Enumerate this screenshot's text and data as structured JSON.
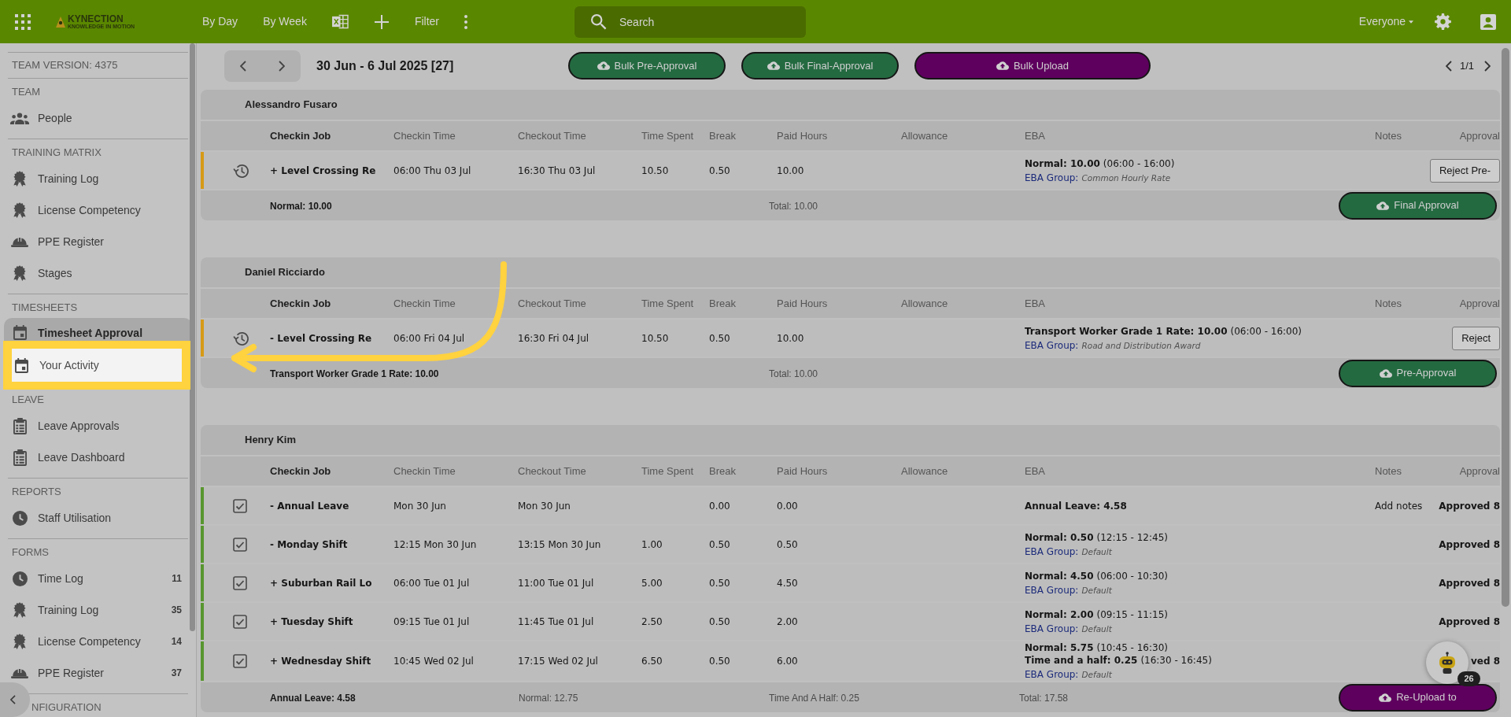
{
  "top_bar": {
    "logo": {
      "name": "KYNECTION",
      "tagline": "KNOWLEDGE IN MOTION"
    },
    "nav": [
      {
        "kind": "text",
        "label": "By Day"
      },
      {
        "kind": "text",
        "label": "By Week"
      },
      {
        "kind": "spreadsheet"
      },
      {
        "kind": "add"
      },
      {
        "kind": "text",
        "label": "Filter"
      },
      {
        "kind": "more"
      }
    ],
    "search": {
      "placeholder": "Search"
    },
    "scope": "Everyone"
  },
  "sidebar": {
    "version": "TEAM VERSION: 4375",
    "sections": [
      {
        "title": "TEAM",
        "items": [
          {
            "kind": "people",
            "label": "People",
            "selected": false,
            "highlighted": false
          }
        ]
      },
      {
        "title": "TRAINING MATRIX",
        "items": [
          {
            "kind": "award",
            "label": "Training Log",
            "selected": false,
            "highlighted": false
          },
          {
            "kind": "award",
            "label": "License Competency",
            "selected": false,
            "highlighted": false
          },
          {
            "kind": "hardhat",
            "label": "PPE Register",
            "selected": false,
            "highlighted": false
          },
          {
            "kind": "award",
            "label": "Stages",
            "selected": false,
            "highlighted": false
          }
        ]
      },
      {
        "title": "TIMESHEETS",
        "items": [
          {
            "kind": "calendar",
            "label": "Timesheet Approval",
            "selected": true,
            "highlighted": false
          },
          {
            "kind": "calendar",
            "label": "Your Activity",
            "selected": false,
            "highlighted": true
          }
        ]
      },
      {
        "title": "LEAVE",
        "items": [
          {
            "kind": "clipboard",
            "label": "Leave Approvals",
            "selected": false,
            "highlighted": false
          },
          {
            "kind": "clipboard",
            "label": "Leave Dashboard",
            "selected": false,
            "highlighted": false
          }
        ]
      },
      {
        "title": "REPORTS",
        "items": [
          {
            "kind": "clock",
            "label": "Staff Utilisation",
            "selected": false,
            "highlighted": false
          }
        ]
      },
      {
        "title": "FORMS",
        "items": [
          {
            "kind": "clock",
            "label": "Time Log",
            "count": "11",
            "selected": false,
            "highlighted": false
          },
          {
            "kind": "award",
            "label": "Training Log",
            "count": "35",
            "selected": false,
            "highlighted": false
          },
          {
            "kind": "award",
            "label": "License Competency",
            "count": "14",
            "selected": false,
            "highlighted": false
          },
          {
            "kind": "hardhat",
            "label": "PPE Register",
            "count": "37",
            "selected": false,
            "highlighted": false
          }
        ]
      }
    ],
    "bottom_heading": "NFIGURATION"
  },
  "toolbar": {
    "date_range": "30 Jun - 6 Jul 2025 [27]",
    "actions": [
      {
        "kind": "approve",
        "label": "Bulk Pre-Approval"
      },
      {
        "kind": "approve",
        "label": "Bulk Final-Approval"
      },
      {
        "kind": "upload",
        "label": "Bulk Upload"
      }
    ],
    "page": "1/1"
  },
  "timesheets": [
    {
      "name": "Alessandro Fusaro",
      "columns": [
        "Checkin Job",
        "Checkin Time",
        "Checkout Time",
        "Time Spent",
        "Break",
        "Paid Hours",
        "Allowance",
        "EBA",
        "Notes",
        "Approval"
      ],
      "rows": [
        {
          "kind": "clock",
          "color": "#d69a17",
          "job": "+ Level Crossing Re",
          "checkin": "06:00 Thu 03 Jul",
          "checkout": "16:30 Thu 03 Jul",
          "time_spent": "10.50",
          "break": "0.50",
          "paid_hours": "10.00",
          "eba": [
            {
              "amount": "Normal: 10.00",
              "range": "(06:00 - 16:00)"
            }
          ],
          "group_label": "EBA Group:",
          "group": "Common Hourly Rate",
          "approval": {
            "kind": "button",
            "label": "Reject Pre-"
          }
        }
      ],
      "footer": {
        "summary": "Normal: 10.00",
        "totals": [
          "Total: 10.00"
        ],
        "action": {
          "kind": "approve",
          "label": "Final Approval"
        }
      }
    },
    {
      "name": "Daniel Ricciardo",
      "columns": [
        "Checkin Job",
        "Checkin Time",
        "Checkout Time",
        "Time Spent",
        "Break",
        "Paid Hours",
        "Allowance",
        "EBA",
        "Notes",
        "Approval"
      ],
      "rows": [
        {
          "kind": "clock",
          "color": "#d69a17",
          "job": "- Level Crossing Re",
          "checkin": "06:00 Fri 04 Jul",
          "checkout": "16:30 Fri 04 Jul",
          "time_spent": "10.50",
          "break": "0.50",
          "paid_hours": "10.00",
          "eba": [
            {
              "amount": "Transport Worker Grade 1 Rate: 10.00",
              "range": "(06:00 - 16:00)"
            }
          ],
          "group_label": "EBA Group:",
          "group": "Road and Distribution Award",
          "approval": {
            "kind": "button",
            "label": "Reject"
          }
        }
      ],
      "footer": {
        "summary": "Transport Worker Grade 1 Rate: 10.00",
        "totals": [
          "Total: 10.00"
        ],
        "action": {
          "kind": "approve",
          "label": "Pre-Approval"
        }
      }
    },
    {
      "name": "Henry Kim",
      "columns": [
        "Checkin Job",
        "Checkin Time",
        "Checkout Time",
        "Time Spent",
        "Break",
        "Paid Hours",
        "Allowance",
        "EBA",
        "Notes",
        "Approval"
      ],
      "rows": [
        {
          "kind": "checkbox",
          "checked": true,
          "color": "#58962f",
          "job": "- Annual Leave",
          "checkin": "Mon 30 Jun",
          "checkout": "Mon 30 Jun",
          "break": "0.00",
          "paid_hours": "0.00",
          "eba": [
            {
              "amount": "Annual Leave: 4.58"
            }
          ],
          "notes": "Add notes",
          "approval": {
            "kind": "status",
            "label": "Approved 8"
          }
        },
        {
          "kind": "checkbox",
          "checked": true,
          "color": "#58962f",
          "job": "- Monday Shift",
          "checkin": "12:15 Mon 30 Jun",
          "checkout": "13:15 Mon 30 Jun",
          "time_spent": "1.00",
          "break": "0.50",
          "paid_hours": "0.50",
          "eba": [
            {
              "amount": "Normal: 0.50",
              "range": "(12:15 - 12:45)"
            }
          ],
          "group_label": "EBA Group:",
          "group": "Default",
          "approval": {
            "kind": "status",
            "label": "Approved 8"
          }
        },
        {
          "kind": "checkbox",
          "checked": true,
          "color": "#58962f",
          "job": "+ Suburban Rail Lo",
          "checkin": "06:00 Tue 01 Jul",
          "checkout": "11:00 Tue 01 Jul",
          "time_spent": "5.00",
          "break": "0.50",
          "paid_hours": "4.50",
          "eba": [
            {
              "amount": "Normal: 4.50",
              "range": "(06:00 - 10:30)"
            }
          ],
          "group_label": "EBA Group:",
          "group": "Default",
          "approval": {
            "kind": "status",
            "label": "Approved 8"
          }
        },
        {
          "kind": "checkbox",
          "checked": true,
          "color": "#58962f",
          "job": "+ Tuesday Shift",
          "checkin": "09:15 Tue 01 Jul",
          "checkout": "11:45 Tue 01 Jul",
          "time_spent": "2.50",
          "break": "0.50",
          "paid_hours": "2.00",
          "eba": [
            {
              "amount": "Normal: 2.00",
              "range": "(09:15 - 11:15)"
            }
          ],
          "group_label": "EBA Group:",
          "group": "Default",
          "approval": {
            "kind": "status",
            "label": "Approved 8"
          }
        },
        {
          "kind": "checkbox",
          "checked": true,
          "color": "#58962f",
          "job": "+ Wednesday Shift",
          "checkin": "10:45 Wed 02 Jul",
          "checkout": "17:15 Wed 02 Jul",
          "time_spent": "6.50",
          "break": "0.50",
          "paid_hours": "6.00",
          "eba": [
            {
              "amount": "Normal: 5.75",
              "range": "(10:45 - 16:30)"
            },
            {
              "amount": "Time and a half: 0.25",
              "range": "(16:30 - 16:45)"
            }
          ],
          "group_label": "EBA Group:",
          "group": "Default",
          "approval": {
            "kind": "status",
            "label": "ved 8"
          }
        }
      ],
      "footer": {
        "summary": "Annual Leave: 4.58",
        "totals": [
          "Normal: 12.75",
          "Time And A Half: 0.25",
          "Total: 17.58"
        ],
        "action": {
          "kind": "upload",
          "label": "Re-Upload to"
        }
      }
    }
  ],
  "chat": {
    "count": "26"
  }
}
